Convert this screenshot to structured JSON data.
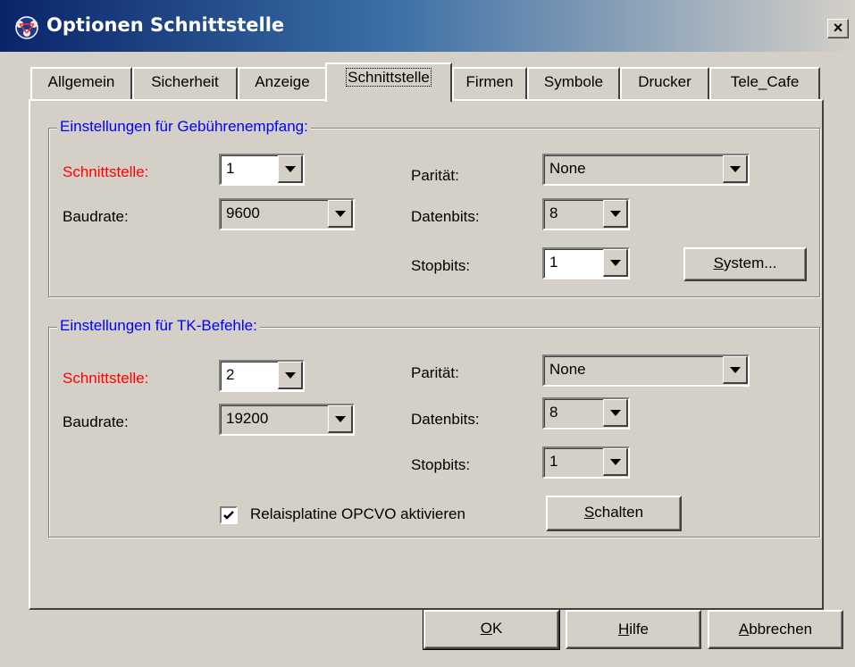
{
  "window": {
    "title": "Optionen Schnittstelle",
    "close_glyph": "×",
    "icon": "app-network-icon"
  },
  "tabs": [
    {
      "label": "Allgemein"
    },
    {
      "label": "Sicherheit"
    },
    {
      "label": "Anzeige"
    },
    {
      "label": "Schnittstelle",
      "active": true
    },
    {
      "label": "Firmen"
    },
    {
      "label": "Symbole"
    },
    {
      "label": "Drucker"
    },
    {
      "label": "Tele_Cafe"
    }
  ],
  "group1": {
    "legend": "Einstellungen für Gebührenempfang:",
    "schnittstelle_label": "Schnittstelle:",
    "schnittstelle_value": "1",
    "baudrate_label": "Baudrate:",
    "baudrate_value": "9600",
    "paritaet_label": "Parität:",
    "paritaet_value": "None",
    "datenbits_label": "Datenbits:",
    "datenbits_value": "8",
    "stopbits_label": "Stopbits:",
    "stopbits_value": "1",
    "system_button_prefix": "S",
    "system_button_rest": "ystem..."
  },
  "group2": {
    "legend": "Einstellungen für TK-Befehle:",
    "schnittstelle_label": "Schnittstelle:",
    "schnittstelle_value": "2",
    "baudrate_label": "Baudrate:",
    "baudrate_value": "19200",
    "paritaet_label": "Parität:",
    "paritaet_value": "None",
    "datenbits_label": "Datenbits:",
    "datenbits_value": "8",
    "stopbits_label": "Stopbits:",
    "stopbits_value": "1",
    "relais_checked": true,
    "relais_label": "Relaisplatine OPCVO aktivieren",
    "schalten_button_prefix": "S",
    "schalten_button_rest": "chalten"
  },
  "footer": {
    "ok_prefix": "O",
    "ok_rest": "K",
    "hilfe_prefix": "H",
    "hilfe_rest": "ilfe",
    "abbrechen_prefix": "A",
    "abbrechen_rest": "bbrechen"
  },
  "colors": {
    "titlebar_start": "#0a246a",
    "titlebar_end": "#3a6ea5",
    "legend": "#0000ff",
    "required_label": "#ff0000",
    "face": "#d4d0c8"
  }
}
